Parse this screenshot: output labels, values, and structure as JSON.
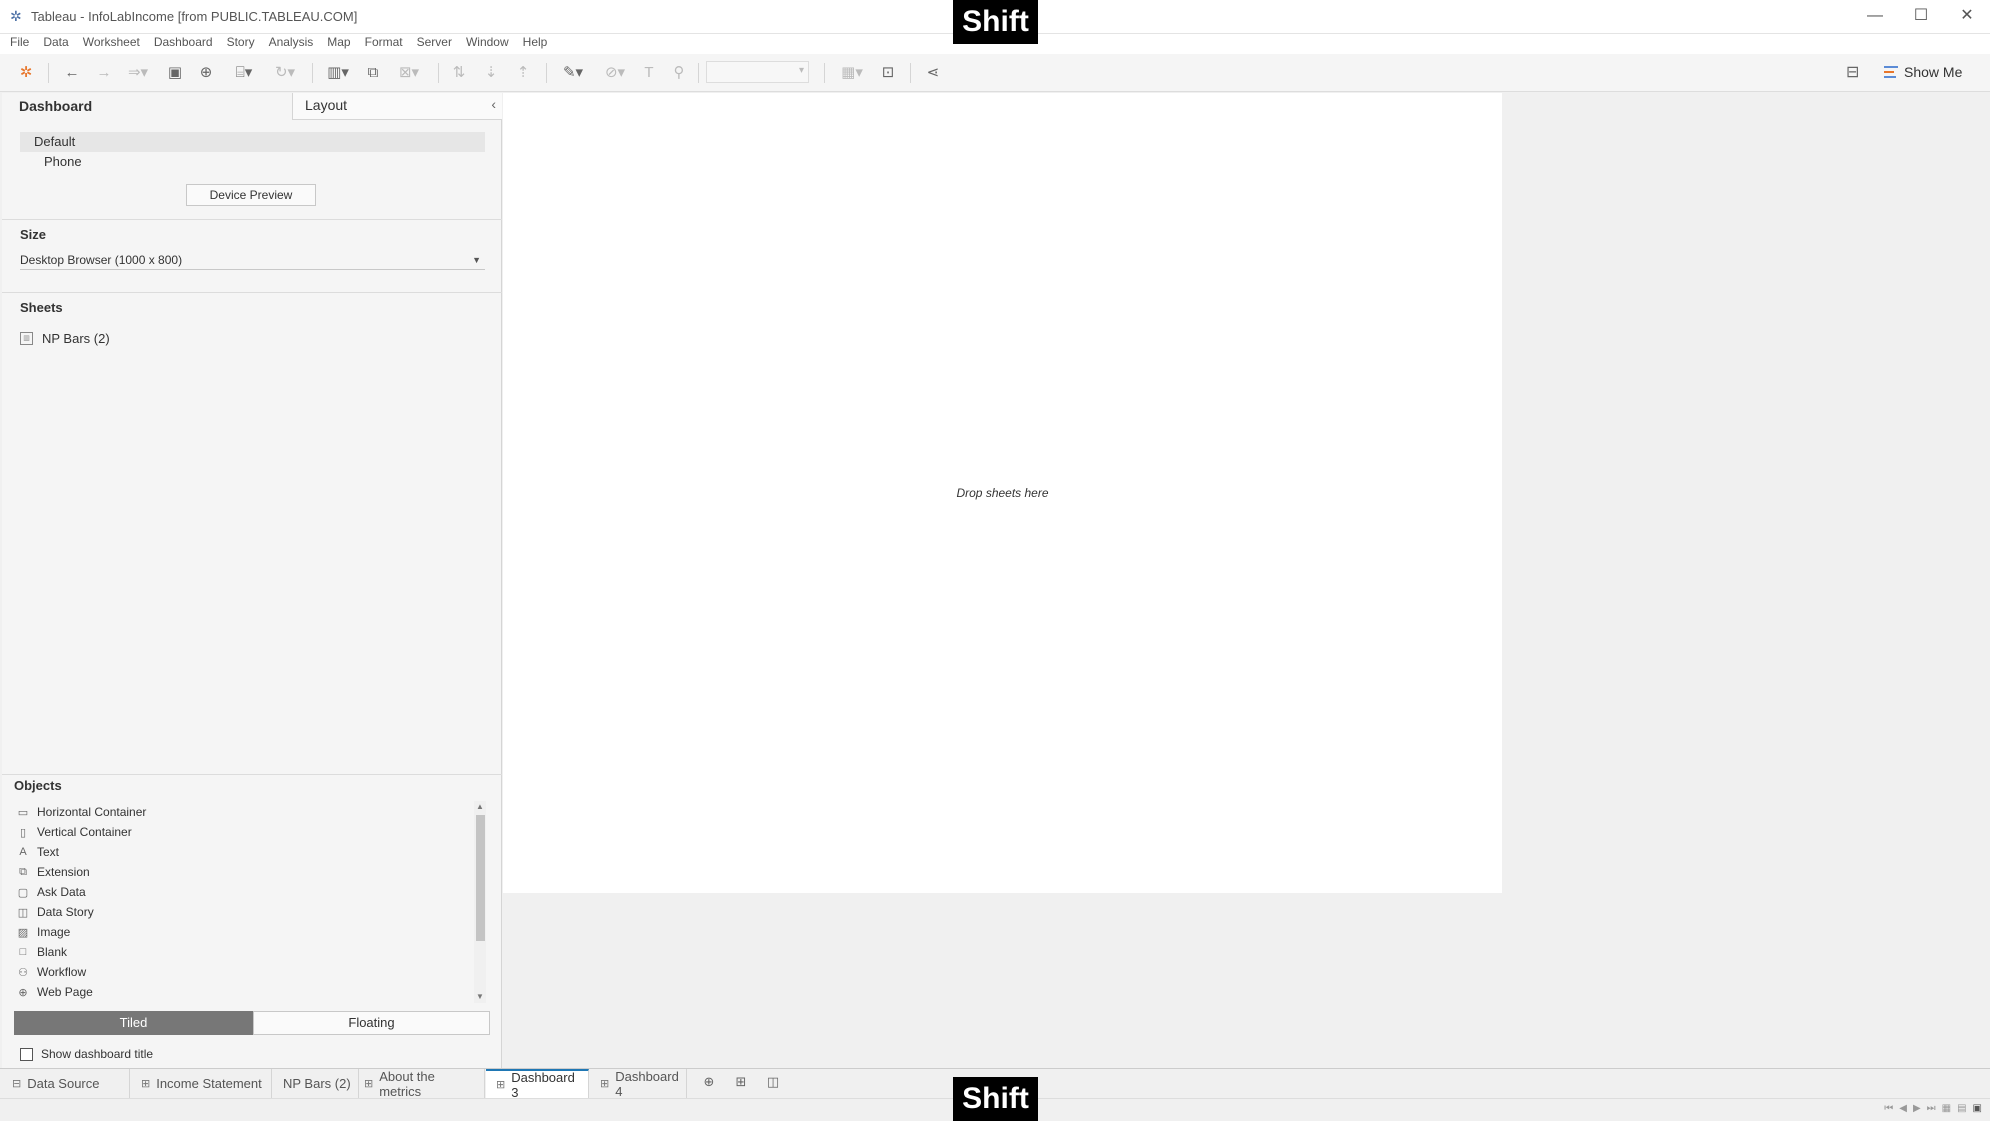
{
  "window": {
    "title": "Tableau - InfoLabIncome [from PUBLIC.TABLEAU.COM]",
    "minimize": "—",
    "maximize": "☐",
    "close": "✕"
  },
  "overlay": {
    "shift_label": "Shift"
  },
  "menu": [
    "File",
    "Data",
    "Worksheet",
    "Dashboard",
    "Story",
    "Analysis",
    "Map",
    "Format",
    "Server",
    "Window",
    "Help"
  ],
  "toolbar": {
    "show_me_label": "Show Me"
  },
  "left_pane": {
    "dashboard_tab": "Dashboard",
    "layout_tab": "Layout",
    "devices": [
      "Default",
      "Phone"
    ],
    "device_preview_label": "Device Preview",
    "size_title": "Size",
    "size_value": "Desktop Browser (1000 x 800)",
    "sheets_title": "Sheets",
    "sheets": [
      "NP Bars (2)"
    ],
    "objects_title": "Objects",
    "objects": [
      "Horizontal Container",
      "Vertical Container",
      "Text",
      "Extension",
      "Ask Data",
      "Data Story",
      "Image",
      "Blank",
      "Workflow",
      "Web Page"
    ],
    "tiled_label": "Tiled",
    "floating_label": "Floating",
    "show_title_label": "Show dashboard title"
  },
  "canvas": {
    "drop_text": "Drop sheets here"
  },
  "bottom_tabs": [
    "Data Source",
    "Income Statement",
    "NP Bars (2)",
    "About the metrics",
    "Dashboard 3",
    "Dashboard 4"
  ],
  "active_tab": "Dashboard 3"
}
